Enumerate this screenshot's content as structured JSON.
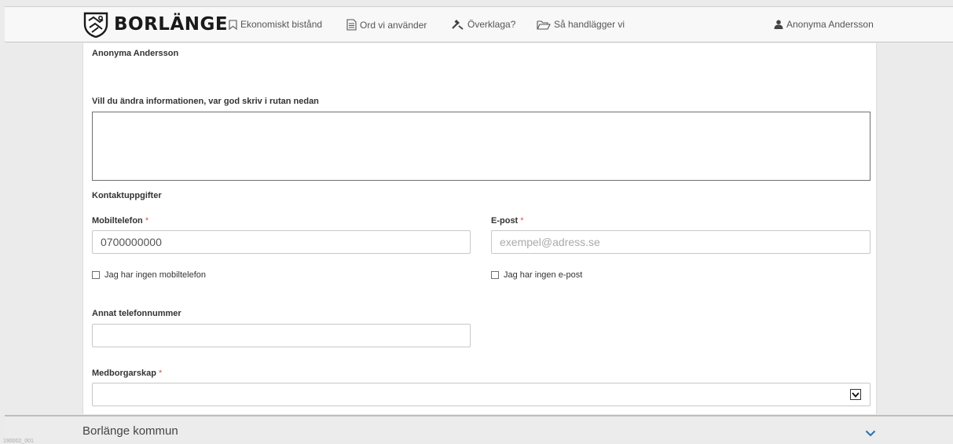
{
  "header": {
    "brand": "BORLÄNGE",
    "nav": [
      {
        "label": "Ekonomiskt bistånd",
        "icon": "bookmark-icon"
      },
      {
        "label": "Ord vi använder",
        "icon": "document-icon"
      },
      {
        "label": "Överklaga?",
        "icon": "gavel-icon"
      },
      {
        "label": "Så handlägger vi",
        "icon": "folder-open-icon"
      }
    ],
    "user": "Anonyma Andersson",
    "user_icon": "user-icon"
  },
  "form": {
    "name": "Anonyma Andersson",
    "change_info_label": "Vill du ändra informationen, var god skriv i rutan nedan",
    "change_info_value": "",
    "contact_heading": "Kontaktuppgifter",
    "mobile_label": "Mobiltelefon",
    "mobile_value": "0700000000",
    "email_label": "E-post",
    "email_placeholder": "exempel@adress.se",
    "required_mark": "*",
    "no_mobile_label": "Jag har ingen mobiltelefon",
    "no_email_label": "Jag har ingen e-post",
    "other_phone_label": "Annat telefonnummer",
    "other_phone_value": "",
    "citizenship_label": "Medborgarskap",
    "citizenship_value": ""
  },
  "footer": {
    "title": "Borlänge kommun",
    "corner_id": "190002_001"
  },
  "colors": {
    "required": "#d9534f",
    "accent_chevron": "#2a6fb0"
  }
}
